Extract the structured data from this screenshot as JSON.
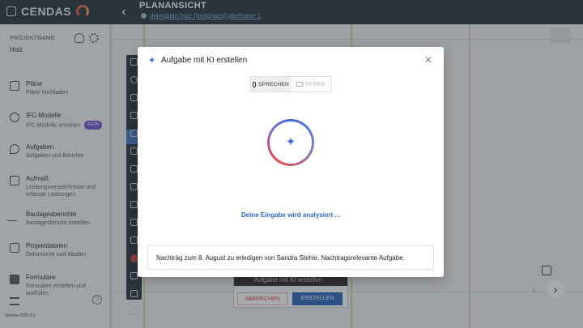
{
  "app": {
    "logo_text": "CENDAS",
    "title": "PLANANSICHT",
    "plan_name": "demoplan holz (fertighaus) plotframe 1"
  },
  "sidebar": {
    "project_label": "PROJEKTNAME",
    "project_name": "Holz",
    "items": [
      {
        "label": "Pläne",
        "sub": "Pläne hochladen",
        "icon": "plans-icon"
      },
      {
        "label": "IFC-Modelle",
        "sub": "IFC-Modelle ansehen",
        "icon": "ifc-icon",
        "badge": "BETA"
      },
      {
        "label": "Aufgaben",
        "sub": "Aufgaben und Berichte",
        "icon": "location-pin-icon"
      },
      {
        "label": "Aufmaß",
        "sub": "Leistungsverzeichnisse und erfasste Leistungen",
        "icon": "document-icon"
      },
      {
        "label": "Bautagesberichte",
        "sub": "Bautagesbericht erstellen",
        "icon": "pen-icon"
      },
      {
        "label": "Projektdateien",
        "sub": "Dokumente und Medien",
        "icon": "files-icon"
      },
      {
        "label": "Formulare",
        "sub": "Formulare erstellen und ausfüllen",
        "icon": "checkbox-icon"
      }
    ],
    "version": "Version 2026.9.2"
  },
  "background_panel": {
    "title": "Aufgabe mit KI erstellen",
    "cancel_label": "ABBRECHEN",
    "create_label": "ERSTELLEN"
  },
  "modal": {
    "title": "Aufgabe mit KI erstellen",
    "mode_speak": "SPRECHEN",
    "mode_type": "TIPPEN",
    "active_mode": "SPRECHEN",
    "status": "Deine Eingabe wird analysiert ...",
    "transcript": "Nachträg zum 8. August zu erledigen von Sandra Stehle. Nachtragsrelevante Aufgabe."
  },
  "colors": {
    "topbar": "#1c2835",
    "accent_blue": "#2d66c8",
    "beta_purple": "#6e4bcf",
    "danger_red": "#d83a32"
  }
}
